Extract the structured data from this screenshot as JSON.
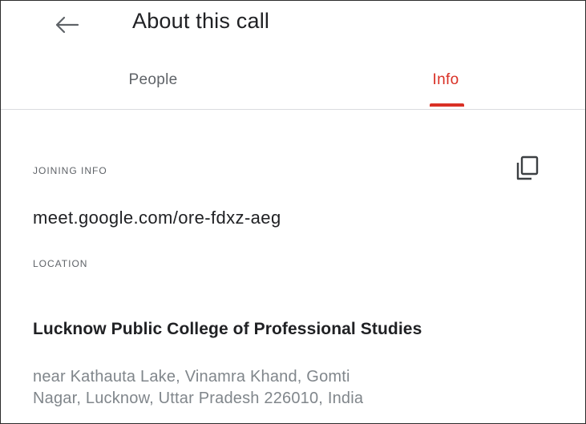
{
  "header": {
    "title": "About this call",
    "back_icon": "arrow-left-icon"
  },
  "tabs": [
    {
      "label": "People",
      "selected": false
    },
    {
      "label": "Info",
      "selected": true
    }
  ],
  "accent_color": "#d93025",
  "joining_info": {
    "label": "JOINING INFO",
    "link": "meet.google.com/ore-fdxz-aeg",
    "copy_icon": "copy-icon"
  },
  "location": {
    "label": "LOCATION",
    "name": "Lucknow Public College of Professional Studies",
    "address_lines": [
      "near Kathauta Lake, Vinamra Khand, Gomti",
      "Nagar, Lucknow, Uttar Pradesh 226010, India"
    ]
  }
}
